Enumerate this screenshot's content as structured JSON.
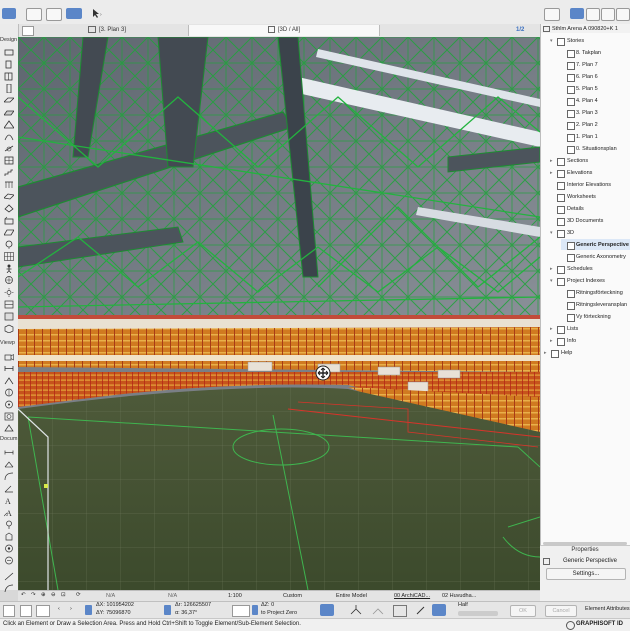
{
  "tabs": {
    "plan": "[3. Plan 3]",
    "view3d": "[3D / All]"
  },
  "toolbox": {
    "design": "Design",
    "viewpoint": "Viewp",
    "document": "Docum"
  },
  "navigator": {
    "project": "Sthlm Arena A 090820+K 1",
    "stories_group": "Stories",
    "stories": [
      "8. Takplan",
      "7. Plan 7",
      "6. Plan 6",
      "5. Plan 5",
      "4. Plan 4",
      "3. Plan 3",
      "2. Plan 2",
      "1. Plan 1",
      "0. Situationsplan"
    ],
    "sections": "Sections",
    "elevations": "Elevations",
    "interior": "Interior Elevations",
    "worksheets": "Worksheets",
    "details": "Details",
    "docs3d": "3D Documents",
    "group3d": "3D",
    "perspective": "Generic Perspective",
    "axonometry": "Generic Axonometry",
    "schedules": "Schedules",
    "indexes": "Project Indexes",
    "index_items": [
      "Ritningsförteckning",
      "Ritningsleveransplan",
      "Vy förteckning"
    ],
    "lists": "Lists",
    "info": "Info",
    "help": "Help"
  },
  "properties": {
    "title": "Properties",
    "value": "Generic Perspective",
    "settings": "Settings..."
  },
  "statusbar": {
    "na1": "N/A",
    "na2": "N/A",
    "scale": "1:100",
    "custom": "Custom",
    "model": "Entire Model",
    "layer": "00 ArchiCAD...",
    "pen": "02 Huvudha..."
  },
  "infobox": {
    "dx": "ΔX: 101954202",
    "dy": "ΔY: 75096870",
    "dr": "Δr: 126625507",
    "da": "α: 36,37°",
    "dz": "ΔZ: 0",
    "ref": "to Project Zero",
    "half": "Half",
    "ok": "OK",
    "cancel": "Cancel",
    "attrs": "Element Attributes"
  },
  "message": "Click an Element or Draw a Selection Area. Press and Hold Ctrl+Shift to Toggle Element/Sub-Element Selection.",
  "brand": "GRAPHISOFT ID",
  "zoom_label": "1/2"
}
